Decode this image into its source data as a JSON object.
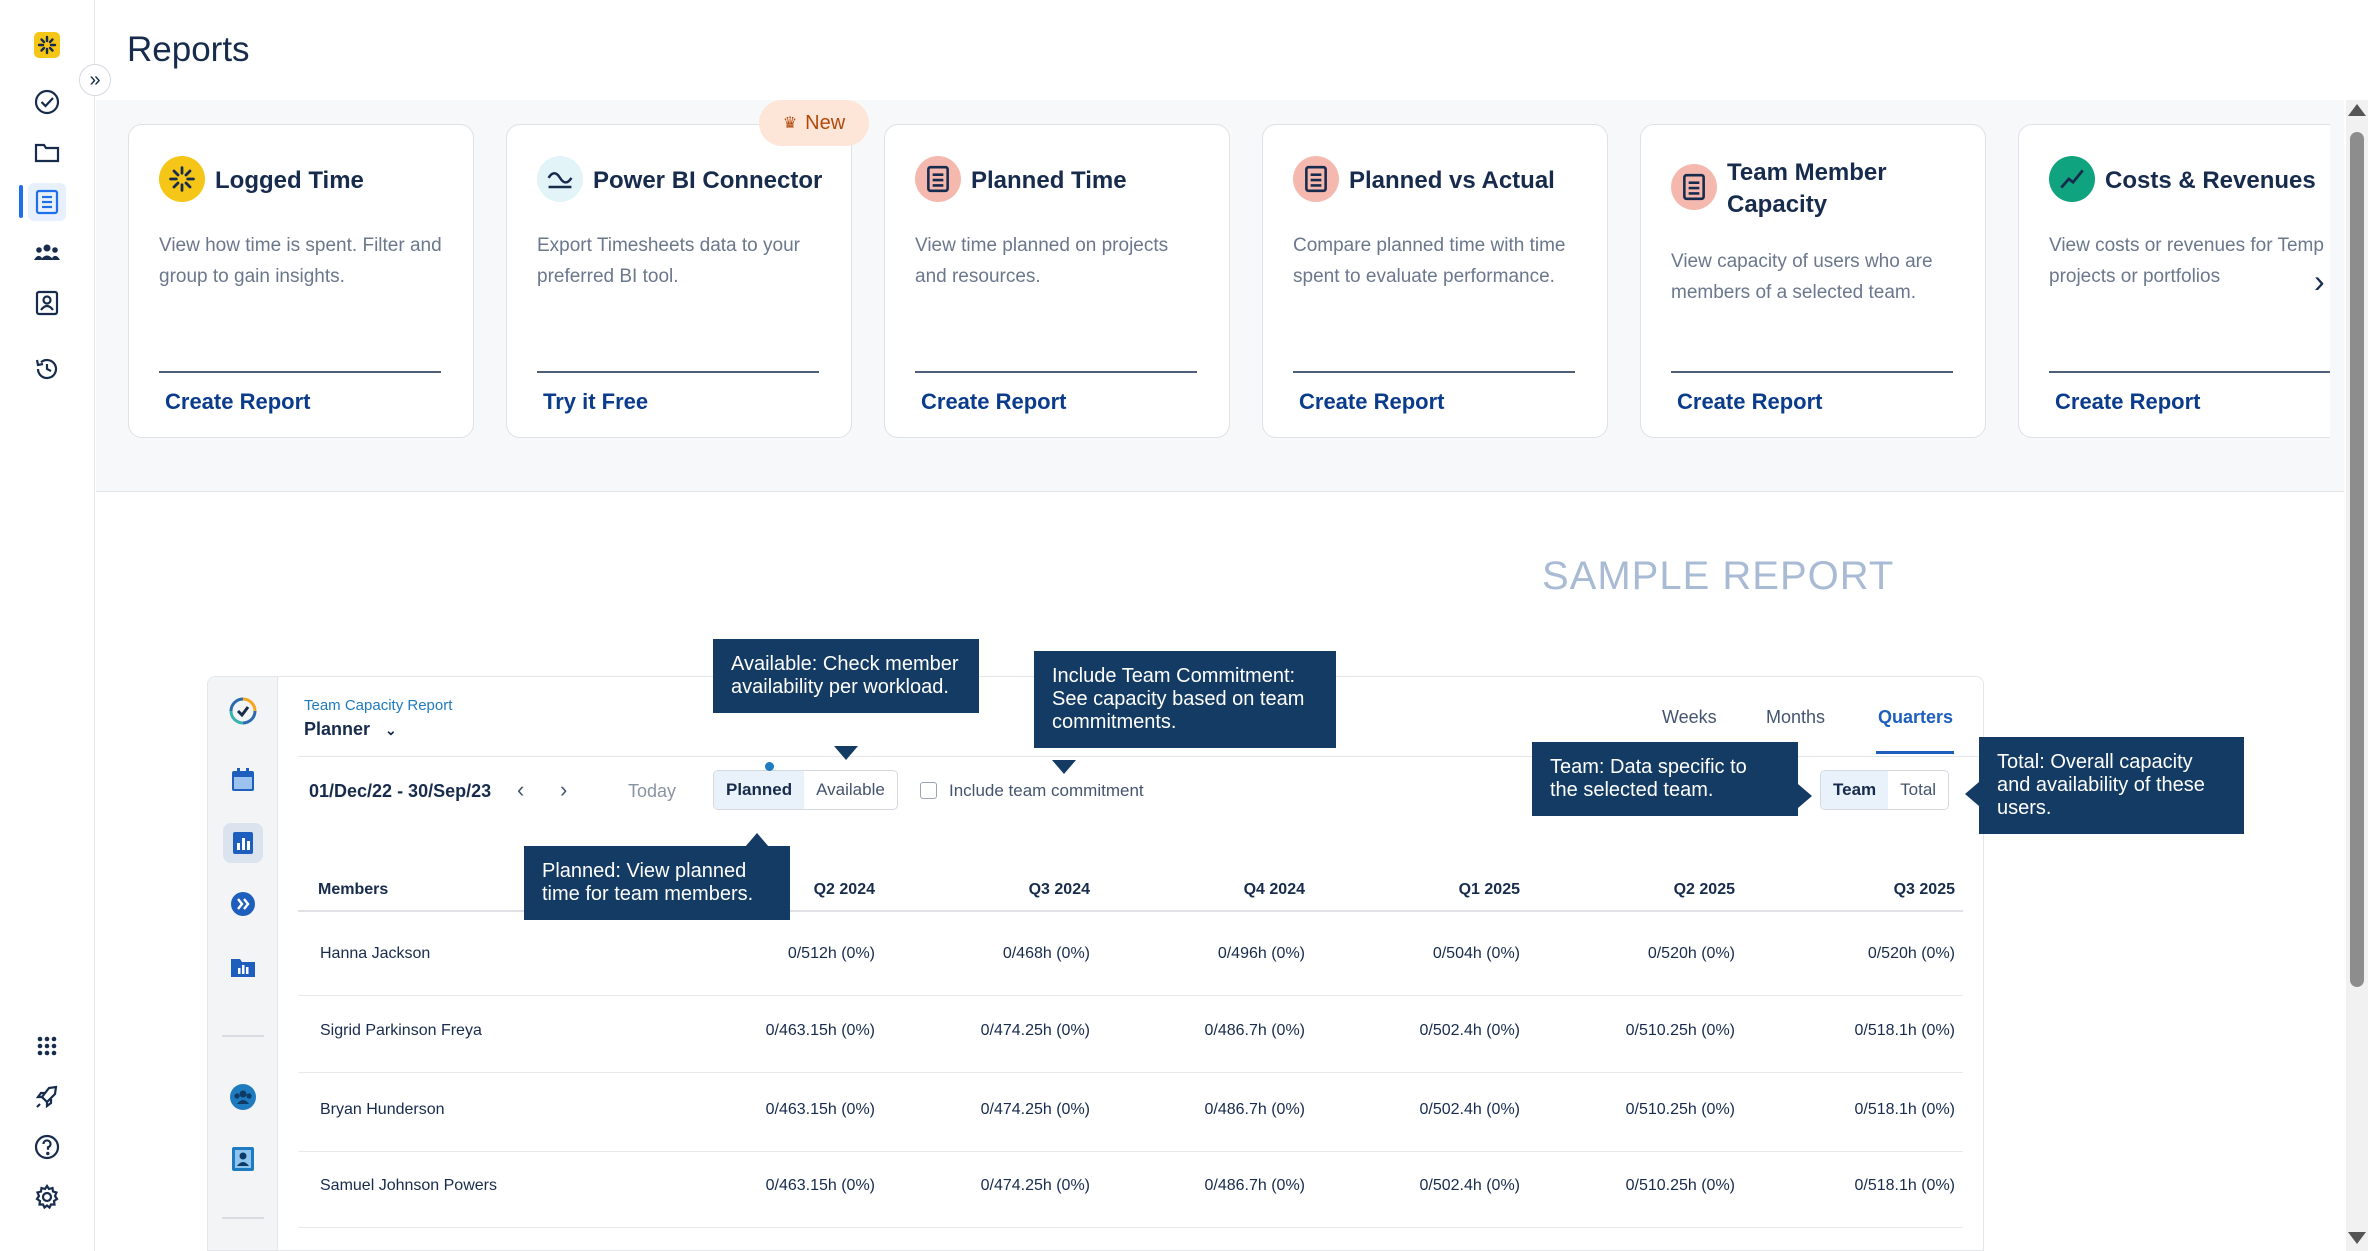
{
  "page": {
    "title": "Reports"
  },
  "sidebar": {
    "icons": [
      "logo-icon",
      "check-circle-icon",
      "folder-icon",
      "reports-icon",
      "team-icon",
      "contact-icon",
      "history-icon",
      "apps-grid-icon",
      "rocket-icon",
      "help-icon",
      "settings-icon"
    ]
  },
  "cards": [
    {
      "title": "Logged Time",
      "description": "View how time is spent. Filter and group to gain insights.",
      "action": "Create Report",
      "icon": "burst-icon"
    },
    {
      "title": "Power BI Connector",
      "description": "Export Timesheets data to your preferred BI tool.",
      "action": "Try it Free",
      "icon": "connector-icon",
      "badge": "New"
    },
    {
      "title": "Planned Time",
      "description": "View time planned on projects and resources.",
      "action": "Create Report",
      "icon": "document-icon"
    },
    {
      "title": "Planned vs Actual",
      "description": "Compare planned time with time spent to evaluate performance.",
      "action": "Create Report",
      "icon": "document-icon"
    },
    {
      "title": "Team Member Capacity",
      "description": "View capacity of users who are members of a selected team.",
      "action": "Create Report",
      "icon": "document-icon"
    },
    {
      "title": "Costs & Revenues",
      "description": "View costs or revenues for Temp projects or portfolios",
      "action": "Create Report",
      "icon": "trend-icon"
    }
  ],
  "sample": {
    "label": "SAMPLE REPORT",
    "report_name": "Team Capacity Report",
    "view": "Planner",
    "tabs": [
      "Weeks",
      "Months",
      "Quarters"
    ],
    "active_tab": "Quarters",
    "date_range": "01/Dec/22 - 30/Sep/23",
    "today": "Today",
    "mode_options": [
      "Planned",
      "Available"
    ],
    "checkbox_label": "Include team commitment",
    "scope_options": [
      "Team",
      "Total"
    ],
    "table": {
      "headers": [
        "Members",
        "Q2 2024",
        "Q3 2024",
        "Q4 2024",
        "Q1 2025",
        "Q2 2025",
        "Q3 2025"
      ],
      "rows": [
        [
          "Hanna Jackson",
          "0/512h (0%)",
          "0/468h (0%)",
          "0/496h (0%)",
          "0/504h (0%)",
          "0/520h (0%)",
          "0/520h (0%)"
        ],
        [
          "Sigrid Parkinson Freya",
          "0/463.15h (0%)",
          "0/474.25h (0%)",
          "0/486.7h (0%)",
          "0/502.4h (0%)",
          "0/510.25h (0%)",
          "0/518.1h (0%)"
        ],
        [
          "Bryan Hunderson",
          "0/463.15h (0%)",
          "0/474.25h (0%)",
          "0/486.7h (0%)",
          "0/502.4h (0%)",
          "0/510.25h (0%)",
          "0/518.1h (0%)"
        ],
        [
          "Samuel Johnson Powers",
          "0/463.15h (0%)",
          "0/474.25h (0%)",
          "0/486.7h (0%)",
          "0/502.4h (0%)",
          "0/510.25h (0%)",
          "0/518.1h (0%)"
        ]
      ]
    },
    "tooltips": {
      "available": "Available: Check member availability per workload.",
      "commitment": "Include Team Commitment: See capacity based on team commitments.",
      "team": "Team: Data specific to the selected team.",
      "total": "Total: Overall capacity and availability of these users.",
      "planned": "Planned: View planned time for team members."
    }
  },
  "colors": {
    "accent": "#1f6feb",
    "link": "#0b3c8c",
    "tooltip": "#133b63",
    "logo": "#f5c518"
  }
}
